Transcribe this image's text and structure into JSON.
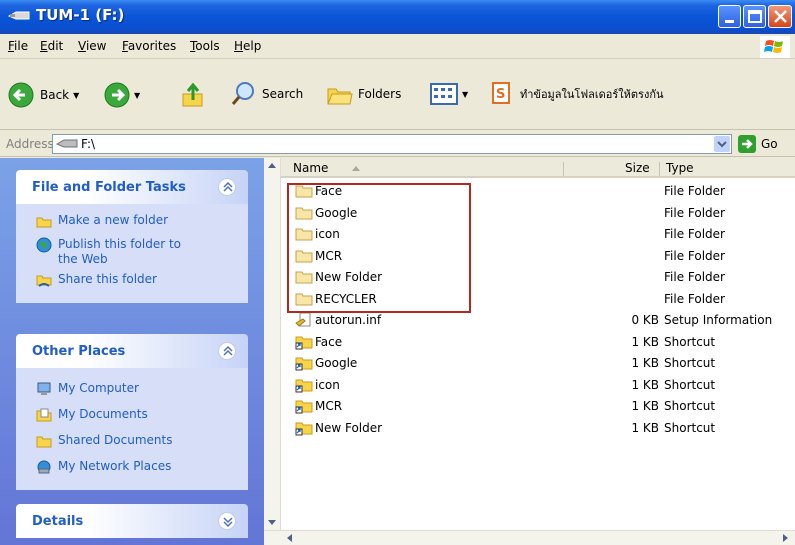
{
  "window": {
    "title": "TUM-1 (F:)"
  },
  "menu": {
    "items": [
      "File",
      "Edit",
      "View",
      "Favorites",
      "Tools",
      "Help"
    ]
  },
  "toolbar": {
    "back_label": "Back",
    "search_label": "Search",
    "folders_label": "Folders",
    "sync_label": "ทำข้อมูลในโฟลเดอร์ให้ตรงกัน"
  },
  "address": {
    "label": "Address",
    "value": "F:\\",
    "go_label": "Go"
  },
  "taskpane": {
    "file_tasks": {
      "title": "File and Folder Tasks",
      "items": [
        {
          "label": "Make a new folder",
          "icon": "new-folder-icon"
        },
        {
          "label": "Publish this folder to the Web",
          "icon": "globe-icon"
        },
        {
          "label": "Share this folder",
          "icon": "share-folder-icon"
        }
      ]
    },
    "other_places": {
      "title": "Other Places",
      "items": [
        {
          "label": "My Computer",
          "icon": "computer-icon"
        },
        {
          "label": "My Documents",
          "icon": "documents-icon"
        },
        {
          "label": "Shared Documents",
          "icon": "shared-folder-icon"
        },
        {
          "label": "My Network Places",
          "icon": "network-icon"
        }
      ]
    },
    "details": {
      "title": "Details"
    }
  },
  "columns": {
    "name": "Name",
    "size": "Size",
    "type": "Type"
  },
  "files": [
    {
      "name": "Face",
      "size": "",
      "type": "File Folder",
      "icon": "folder-icon"
    },
    {
      "name": "Google",
      "size": "",
      "type": "File Folder",
      "icon": "folder-icon"
    },
    {
      "name": "icon",
      "size": "",
      "type": "File Folder",
      "icon": "folder-icon"
    },
    {
      "name": "MCR",
      "size": "",
      "type": "File Folder",
      "icon": "folder-icon"
    },
    {
      "name": "New Folder",
      "size": "",
      "type": "File Folder",
      "icon": "folder-icon"
    },
    {
      "name": "RECYCLER",
      "size": "",
      "type": "File Folder",
      "icon": "folder-icon"
    },
    {
      "name": "autorun.inf",
      "size": "0 KB",
      "type": "Setup Information",
      "icon": "setup-file-icon"
    },
    {
      "name": "Face",
      "size": "1 KB",
      "type": "Shortcut",
      "icon": "folder-shortcut-icon"
    },
    {
      "name": "Google",
      "size": "1 KB",
      "type": "Shortcut",
      "icon": "folder-shortcut-icon"
    },
    {
      "name": "icon",
      "size": "1 KB",
      "type": "Shortcut",
      "icon": "folder-shortcut-icon"
    },
    {
      "name": "MCR",
      "size": "1 KB",
      "type": "Shortcut",
      "icon": "folder-shortcut-icon"
    },
    {
      "name": "New Folder",
      "size": "1 KB",
      "type": "Shortcut",
      "icon": "folder-shortcut-icon"
    }
  ],
  "colors": {
    "title_bar": "#0a55d8",
    "task_link": "#215dc6",
    "highlight_box": "#b4281f"
  }
}
